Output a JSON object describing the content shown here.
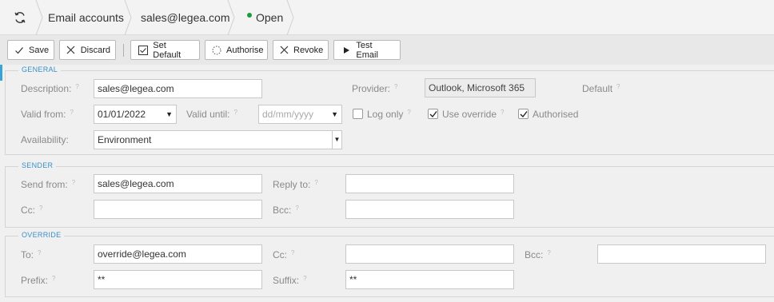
{
  "breadcrumb": {
    "refresh_icon": "refresh-icon",
    "section": "Email accounts",
    "record": "sales@legea.com",
    "status": "Open",
    "status_color": "#1e9a3b"
  },
  "toolbar": {
    "save": "Save",
    "discard": "Discard",
    "set_default": "Set Default",
    "authorise": "Authorise",
    "revoke": "Revoke",
    "test_email": "Test Email"
  },
  "general": {
    "title": "GENERAL",
    "description_label": "Description:",
    "description_value": "sales@legea.com",
    "provider_label": "Provider:",
    "provider_value": "Outlook, Microsoft 365",
    "default_label": "Default",
    "valid_from_label": "Valid from:",
    "valid_from_value": "01/01/2022",
    "valid_until_label": "Valid until:",
    "valid_until_placeholder": "dd/mm/yyyy",
    "log_only_label": "Log only",
    "log_only_checked": false,
    "use_override_label": "Use override",
    "use_override_checked": true,
    "authorised_label": "Authorised",
    "authorised_checked": true,
    "availability_label": "Availability:",
    "availability_value": "Environment"
  },
  "sender": {
    "title": "SENDER",
    "send_from_label": "Send from:",
    "send_from_value": "sales@legea.com",
    "reply_to_label": "Reply to:",
    "reply_to_value": "",
    "cc_label": "Cc:",
    "cc_value": "",
    "bcc_label": "Bcc:",
    "bcc_value": ""
  },
  "override": {
    "title": "OVERRIDE",
    "to_label": "To:",
    "to_value": "override@legea.com",
    "cc_label": "Cc:",
    "cc_value": "",
    "bcc_label": "Bcc:",
    "bcc_value": "",
    "prefix_label": "Prefix:",
    "prefix_value": "**",
    "suffix_label": "Suffix:",
    "suffix_value": "**"
  },
  "help_mark": "?"
}
